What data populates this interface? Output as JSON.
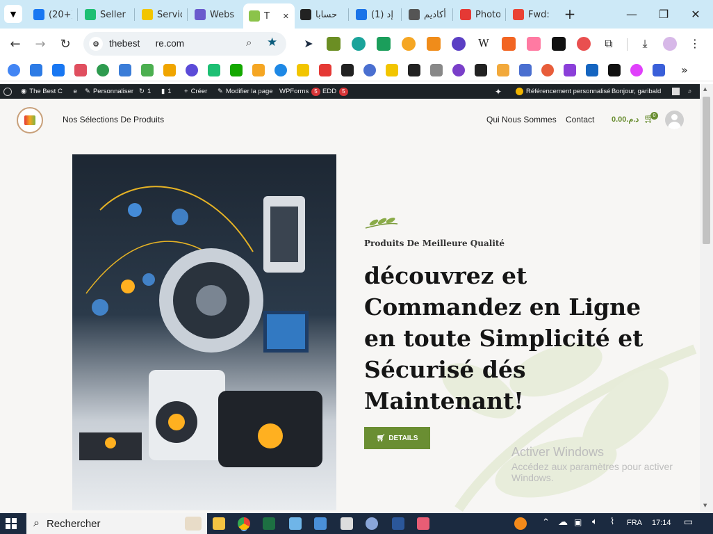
{
  "tabs": [
    {
      "label": "(20+)",
      "icon": "facebook-icon",
      "color": "#1877f2"
    },
    {
      "label": "Seller",
      "icon": "fiverr-icon",
      "color": "#1dbf73"
    },
    {
      "label": "Servic",
      "icon": "service-icon",
      "color": "#f2c500"
    },
    {
      "label": "Webs",
      "icon": "webs-icon",
      "color": "#6a5acd"
    },
    {
      "label": "T",
      "icon": "active-site-icon",
      "color": "#8bc34a"
    },
    {
      "label": "حسابا",
      "icon": "threads-icon",
      "color": "#222222"
    },
    {
      "label": "(1) إد",
      "icon": "notification-icon",
      "color": "#1a73e8"
    },
    {
      "label": "أكاديم",
      "icon": "academy-icon",
      "color": "#555555"
    },
    {
      "label": "Photo",
      "icon": "photo-icon",
      "color": "#e53935"
    },
    {
      "label": "Fwd:",
      "icon": "gmail-icon",
      "color": "#ea4335"
    }
  ],
  "url": "thebest      re.com",
  "admin_bar": {
    "site": "The Best C      e",
    "customize": "Personnaliser",
    "updates": "1",
    "comments": "1",
    "new": "Créer",
    "edit": "Modifier la page",
    "wpforms": "WPForms",
    "wpforms_count": "5",
    "edd": "EDD",
    "edd_count": "5",
    "seo": "Référencement personnalisé",
    "greeting": "Bonjour, garibald"
  },
  "site_nav": {
    "products": "Nos Sélections De Produits",
    "about": "Qui Nous Sommes",
    "contact": "Contact",
    "cart_total": "د.م.0.00",
    "cart_count": "0"
  },
  "hero": {
    "kicker": "Produits De Meilleure Qualité",
    "headline": "découvrez et Commandez en Ligne en toute Simplicité et Sécurisé dés Maintenant!",
    "button": "DETAILS"
  },
  "watermark": {
    "title": "Activer Windows",
    "line1": "Accédez aux paramètres pour activer",
    "line2": "Windows."
  },
  "taskbar": {
    "search": "Rechercher",
    "lang": "FRA",
    "time": "17:14"
  },
  "colors": {
    "accent": "#6a8e32",
    "adminbar": "#1d2327",
    "tabstrip": "#cde9f7"
  }
}
